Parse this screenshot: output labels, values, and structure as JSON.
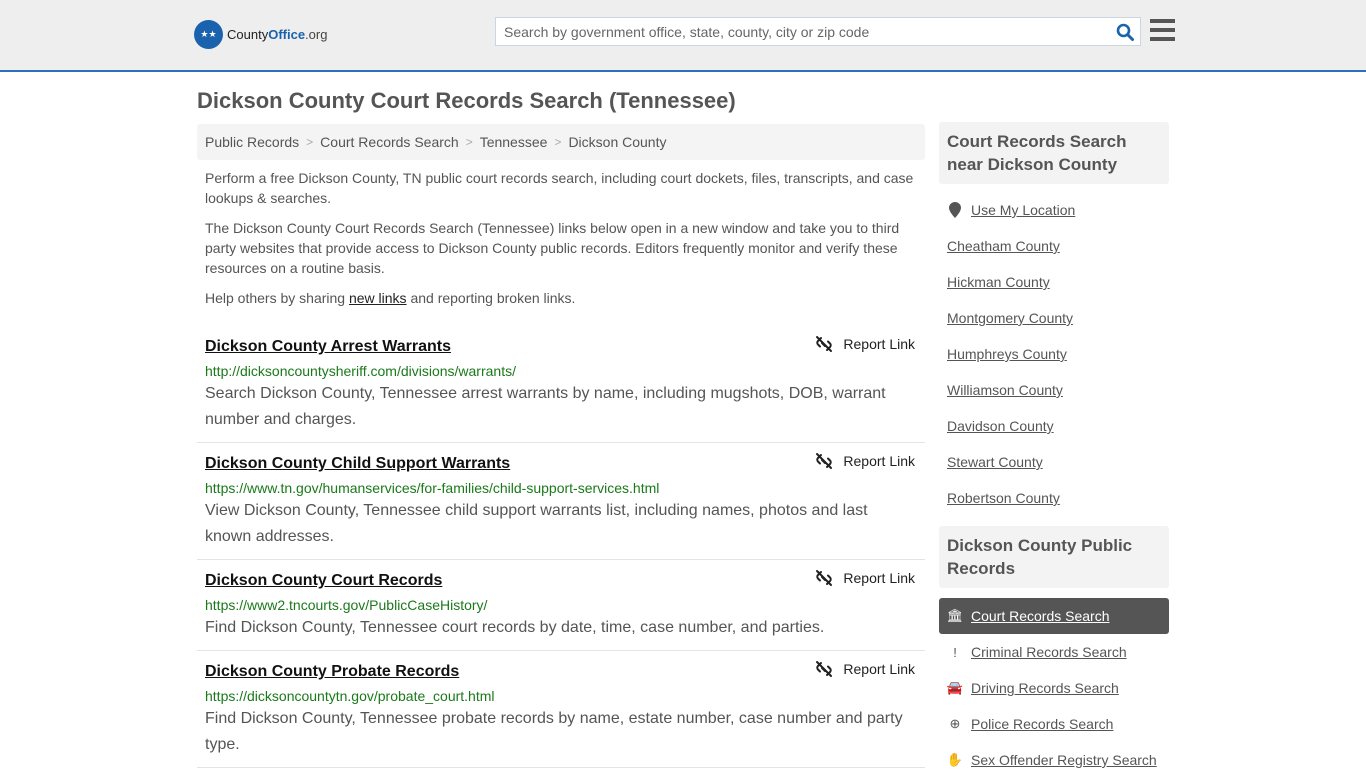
{
  "header": {
    "logo_county": "County",
    "logo_office": "Office",
    "logo_org": ".org",
    "search_placeholder": "Search by government office, state, county, city or zip code"
  },
  "page_title": "Dickson County Court Records Search (Tennessee)",
  "breadcrumb": [
    "Public Records",
    "Court Records Search",
    "Tennessee",
    "Dickson County"
  ],
  "intro": {
    "p1": "Perform a free Dickson County, TN public court records search, including court dockets, files, transcripts, and case lookups & searches.",
    "p2": "The Dickson County Court Records Search (Tennessee) links below open in a new window and take you to third party websites that provide access to Dickson County public records. Editors frequently monitor and verify these resources on a routine basis.",
    "p3_pre": "Help others by sharing ",
    "p3_link": "new links",
    "p3_post": " and reporting broken links."
  },
  "report_label": "Report Link",
  "results": [
    {
      "title": "Dickson County Arrest Warrants",
      "url": "http://dicksoncountysheriff.com/divisions/warrants/",
      "desc": "Search Dickson County, Tennessee arrest warrants by name, including mugshots, DOB, warrant number and charges."
    },
    {
      "title": "Dickson County Child Support Warrants",
      "url": "https://www.tn.gov/humanservices/for-families/child-support-services.html",
      "desc": "View Dickson County, Tennessee child support warrants list, including names, photos and last known addresses."
    },
    {
      "title": "Dickson County Court Records",
      "url": "https://www2.tncourts.gov/PublicCaseHistory/",
      "desc": "Find Dickson County, Tennessee court records by date, time, case number, and parties."
    },
    {
      "title": "Dickson County Probate Records",
      "url": "https://dicksoncountytn.gov/probate_court.html",
      "desc": "Find Dickson County, Tennessee probate records by name, estate number, case number and party type."
    }
  ],
  "sidebar": {
    "near_title": "Court Records Search near Dickson County",
    "use_location": "Use My Location",
    "near": [
      "Cheatham County",
      "Hickman County",
      "Montgomery County",
      "Humphreys County",
      "Williamson County",
      "Davidson County",
      "Stewart County",
      "Robertson County"
    ],
    "public_title": "Dickson County Public Records",
    "public": [
      {
        "label": "Court Records Search",
        "icon": "courthouse-icon",
        "glyph": "🏛",
        "active": true
      },
      {
        "label": "Criminal Records Search",
        "icon": "exclamation-icon",
        "glyph": "!",
        "active": false
      },
      {
        "label": "Driving Records Search",
        "icon": "car-icon",
        "glyph": "🚘",
        "active": false
      },
      {
        "label": "Police Records Search",
        "icon": "crosshairs-icon",
        "glyph": "⊕",
        "active": false
      },
      {
        "label": "Sex Offender Registry Search",
        "icon": "hand-icon",
        "glyph": "✋",
        "active": false
      }
    ]
  }
}
